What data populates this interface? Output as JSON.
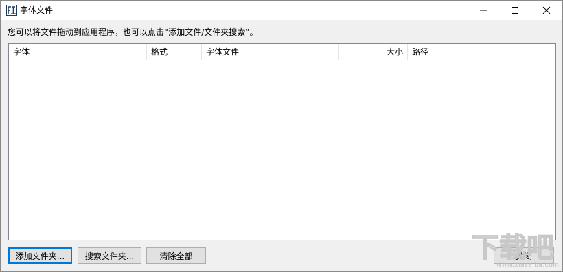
{
  "window": {
    "title": "字体文件",
    "icon": "app-font-icon",
    "controls": [
      "minimize-icon",
      "maximize-icon",
      "close-icon"
    ]
  },
  "hint_text": "您可以将文件拖动到应用程序，也可以点击“添加文件/文件夹搜索”。",
  "table": {
    "columns": [
      "字体",
      "格式",
      "字体文件",
      "大小",
      "路径"
    ],
    "rows": []
  },
  "buttons": {
    "add_folder": "添加文件夹...",
    "search_folder": "搜索文件夹...",
    "clear_all": "清除全部",
    "close": "关闭"
  },
  "watermark": {
    "text": "下载吧",
    "sub": "www.xiazaiba.com"
  },
  "colors": {
    "accent": "#0078d7",
    "window_bg": "#f0f0f0",
    "table_border": "#828790"
  }
}
